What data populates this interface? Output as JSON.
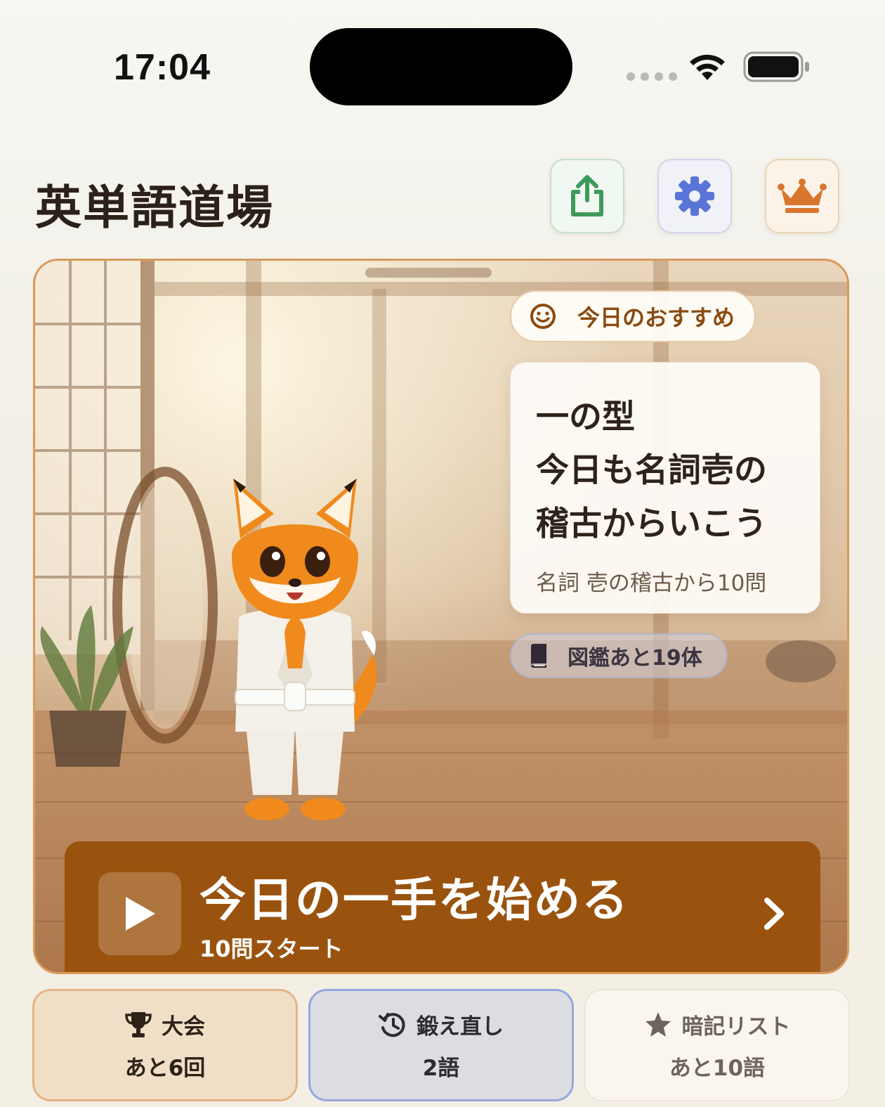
{
  "status_bar": {
    "time": "17:04"
  },
  "header": {
    "title": "英単語道場"
  },
  "hero": {
    "recommend_chip": "今日のおすすめ",
    "recommend_headline": "一の型\n今日も名詞壱の\n稽古からいこう",
    "recommend_sub": "名詞 壱の稽古から10問",
    "zukan_chip": "図鑑あと19体",
    "start_title": "今日の一手を始める",
    "start_sub": "10問スタート"
  },
  "tiles": [
    {
      "label": "大会",
      "value": "あと6回",
      "icon": "trophy-icon"
    },
    {
      "label": "鍛え直し",
      "value": "2語",
      "icon": "history-icon"
    },
    {
      "label": "暗記リスト",
      "value": "あと10語",
      "icon": "star-icon"
    }
  ],
  "colors": {
    "accent_brown": "#9a530e",
    "share_green": "#3e9a5c",
    "settings_blue": "#5b74d8",
    "crown_orange": "#d8762e"
  }
}
